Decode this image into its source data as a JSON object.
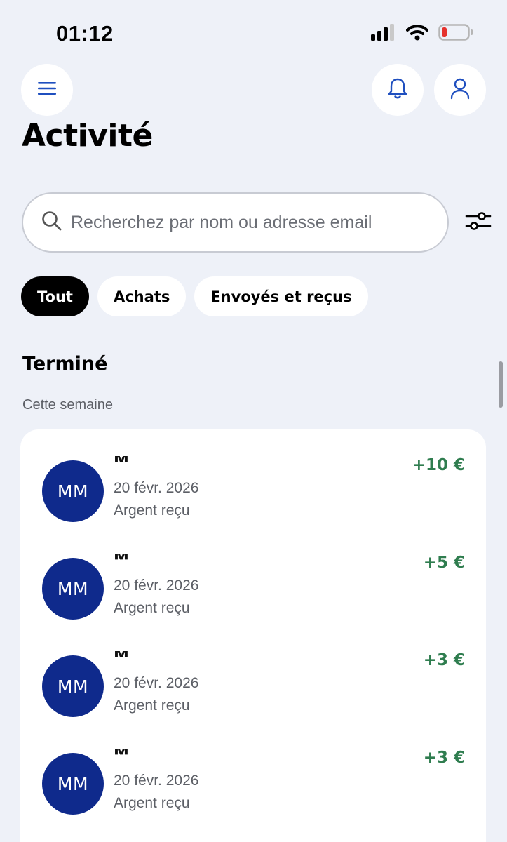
{
  "status_bar": {
    "time": "01:12",
    "signal_icon": "cellular-signal-icon",
    "wifi_icon": "wifi-icon",
    "battery_icon": "battery-low-icon",
    "battery_level": 0.15
  },
  "header": {
    "title": "Activité"
  },
  "search": {
    "placeholder": "Recherchez par nom ou adresse email"
  },
  "filters": {
    "chips": [
      {
        "label": "Tout",
        "active": true
      },
      {
        "label": "Achats",
        "active": false
      },
      {
        "label": "Envoyés et reçus",
        "active": false
      }
    ]
  },
  "section": {
    "title": "Terminé",
    "subtitle": "Cette semaine"
  },
  "transactions": [
    {
      "initials": "MM",
      "name": "M",
      "date": "20 févr. 2026",
      "type": "Argent reçu",
      "amount": "+10 €"
    },
    {
      "initials": "MM",
      "name": "M",
      "date": "20 févr. 2026",
      "type": "Argent reçu",
      "amount": "+5 €"
    },
    {
      "initials": "MM",
      "name": "M",
      "date": "20 févr. 2026",
      "type": "Argent reçu",
      "amount": "+3 €"
    },
    {
      "initials": "MM",
      "name": "M",
      "date": "20 févr. 2026",
      "type": "Argent reçu",
      "amount": "+3 €"
    }
  ],
  "colors": {
    "background": "#eef1f8",
    "accent_icon": "#1f4fbf",
    "avatar": "#0f2a8c",
    "amount_positive": "#2f7d4f",
    "battery_low": "#e5322d"
  }
}
